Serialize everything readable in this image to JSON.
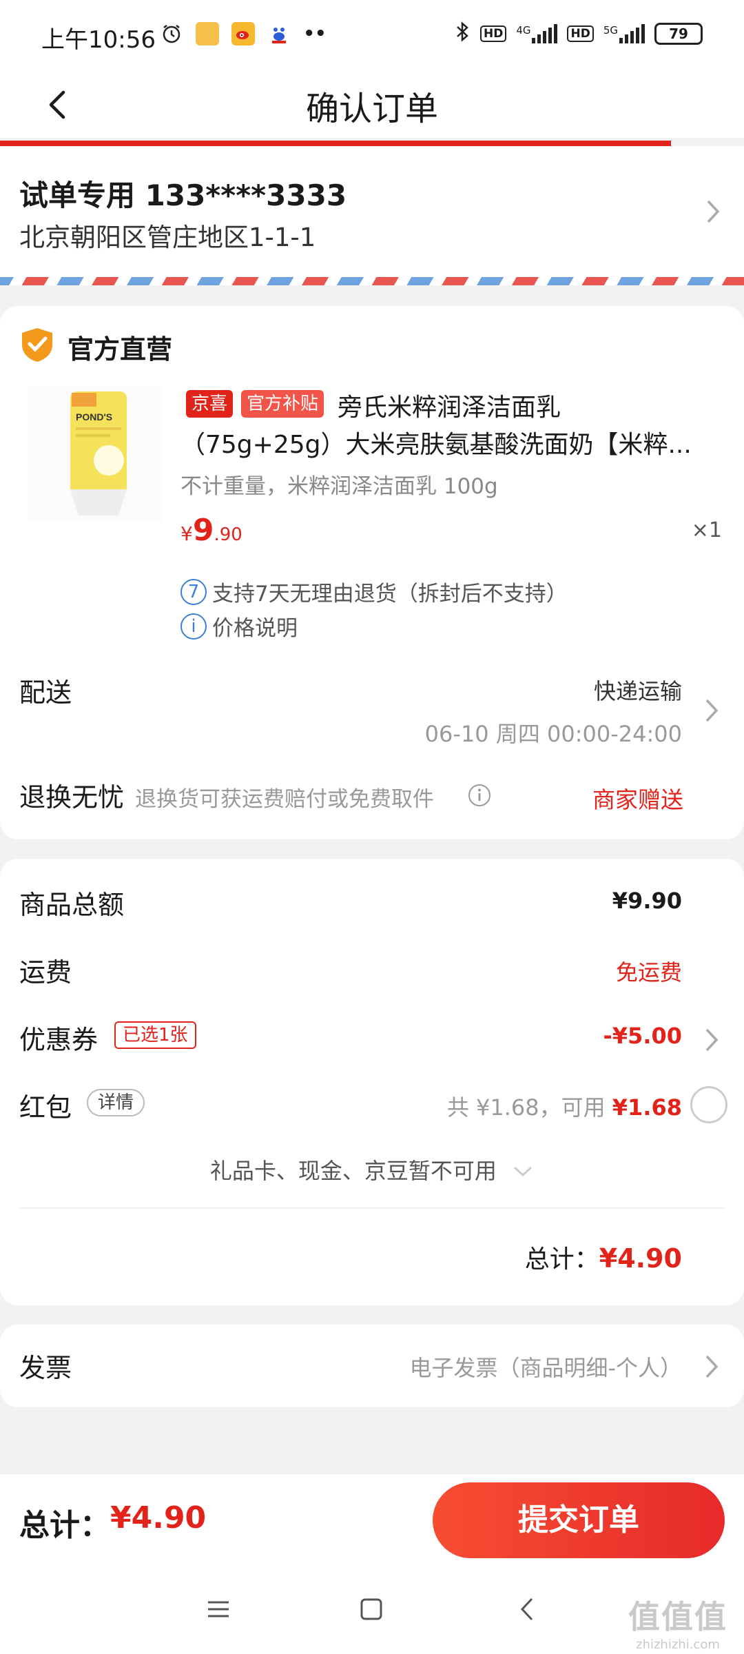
{
  "status_bar": {
    "time": "上午10:56",
    "battery": "79",
    "net1": "4G",
    "net2": "5G",
    "hd": "HD",
    "more": "••"
  },
  "header": {
    "title": "确认订单"
  },
  "address": {
    "name_phone": "试单专用 133****3333",
    "detail": "北京朝阳区管庄地区1-1-1"
  },
  "shop": {
    "name": "官方直营",
    "product": {
      "tag1": "京喜",
      "tag2": "官方补贴",
      "title_line1": "旁氏米粹润泽洁面乳",
      "title_line2": "（75g+25g）大米亮肤氨基酸洗面奶【米粹...",
      "spec": "不计重量，米粹润泽洁面乳 100g",
      "price_symbol": "¥",
      "price_int": "9",
      "price_dec": ".90",
      "quantity": "×1",
      "image_brand": "POND'S"
    },
    "services": [
      {
        "icon": "7",
        "text": "支持7天无理由退货（拆封后不支持）"
      },
      {
        "icon": "i",
        "text": "价格说明"
      }
    ],
    "delivery": {
      "label": "配送",
      "method": "快递运输",
      "time": "06-10 周四 00:00-24:00"
    },
    "return": {
      "label": "退换无忧",
      "desc": "退换货可获运费赔付或免费取件",
      "value": "商家赠送"
    }
  },
  "summary": {
    "goods_total_label": "商品总额",
    "goods_total_value": "¥9.90",
    "shipping_label": "运费",
    "shipping_value": "免运费",
    "coupon_label": "优惠券",
    "coupon_badge": "已选1张",
    "coupon_value": "-¥5.00",
    "redpacket_label": "红包",
    "redpacket_badge": "详情",
    "redpacket_total": "共 ¥1.68，可用 ",
    "redpacket_avail": "¥1.68",
    "unavailable_note": "礼品卡、现金、京豆暂不可用",
    "total_label": "总计：",
    "total_value": "¥4.90"
  },
  "invoice": {
    "label": "发票",
    "value": "电子发票（商品明细-个人）"
  },
  "bottom_bar": {
    "total_label": "总计：",
    "total_value": "¥4.90",
    "submit_label": "提交订单"
  },
  "watermark": {
    "main": "值值值",
    "sub": "zhizhizhi.com"
  },
  "colors": {
    "accent": "#e2231a",
    "button": "#f74d32",
    "info_blue": "#3b7fd6"
  }
}
